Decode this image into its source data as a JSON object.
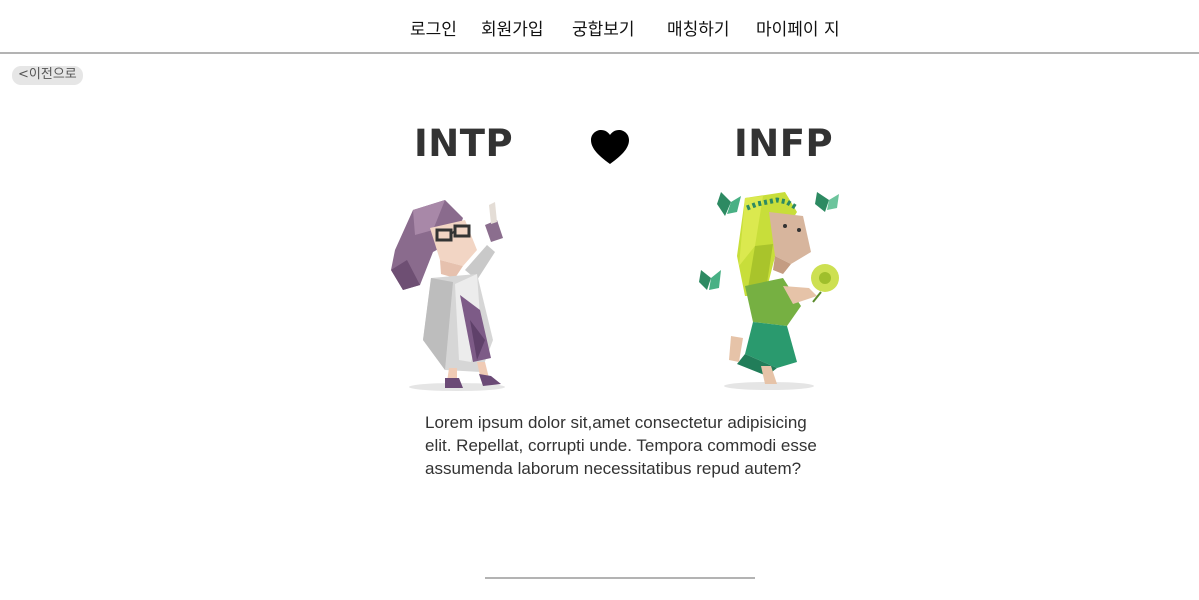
{
  "nav": {
    "items": [
      {
        "label": "로그인"
      },
      {
        "label": "회원가입"
      },
      {
        "label": "궁합보기"
      },
      {
        "label": "매칭하기"
      },
      {
        "label": "마이페이 지"
      }
    ]
  },
  "back_button": {
    "label": "<이전으로"
  },
  "match": {
    "left_type": "INTP",
    "right_type": "INFP",
    "heart_icon": "heart-icon",
    "description": "Lorem ipsum dolor sit,amet consectetur adipisicing elit. Repellat, corrupti unde. Tempora commodi esse assumenda laborum necessitatibus repud autem?"
  },
  "colors": {
    "nav_border": "#b3b3b3",
    "heading": "#333333",
    "back_bg": "#e6e6e6"
  }
}
